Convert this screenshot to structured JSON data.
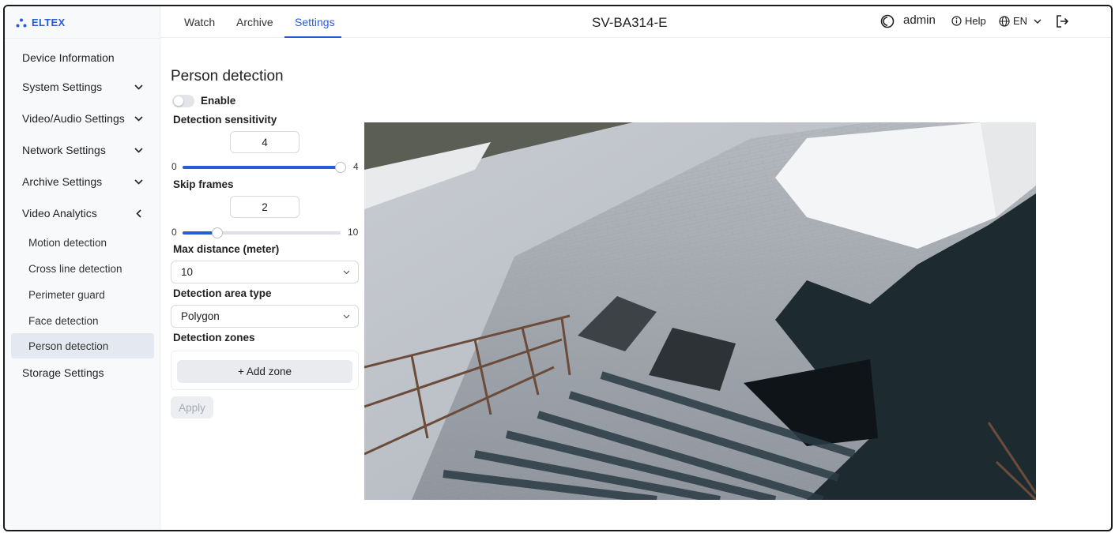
{
  "app": {
    "logo_text": "ELTEX",
    "device_title": "SV-BA314-E"
  },
  "header": {
    "tabs": [
      {
        "label": "Watch"
      },
      {
        "label": "Archive"
      },
      {
        "label": "Settings",
        "active": true
      }
    ],
    "user": "admin",
    "help": "Help",
    "language": "EN"
  },
  "sidebar": {
    "items": [
      {
        "label": "Device Information"
      },
      {
        "label": "System Settings",
        "chevron": "down"
      },
      {
        "label": "Video/Audio Settings",
        "chevron": "down"
      },
      {
        "label": "Network Settings",
        "chevron": "down"
      },
      {
        "label": "Archive Settings",
        "chevron": "down"
      },
      {
        "label": "Video Analytics",
        "chevron": "left"
      },
      {
        "label": "Storage Settings"
      }
    ],
    "analytics_sub": [
      {
        "label": "Motion detection"
      },
      {
        "label": "Cross line detection"
      },
      {
        "label": "Perimeter guard"
      },
      {
        "label": "Face detection"
      },
      {
        "label": "Person detection",
        "active": true
      }
    ]
  },
  "form": {
    "title": "Person detection",
    "enable_label": "Enable",
    "enabled": false,
    "sensitivity": {
      "label": "Detection sensitivity",
      "value": "4",
      "min": "0",
      "max": "4",
      "level": 1.0
    },
    "skip_frames": {
      "label": "Skip frames",
      "value": "2",
      "min": "0",
      "max": "10",
      "level": 0.2
    },
    "max_distance": {
      "label": "Max distance (meter)",
      "value": "10"
    },
    "area_type": {
      "label": "Detection area type",
      "value": "Polygon"
    },
    "zones": {
      "label": "Detection zones",
      "add_label": "+ Add zone"
    },
    "apply_label": "Apply"
  },
  "colors": {
    "accent": "#2a5bd7",
    "sidebar_bg": "#f8f9fb",
    "active_bg": "#e4e8f1"
  }
}
